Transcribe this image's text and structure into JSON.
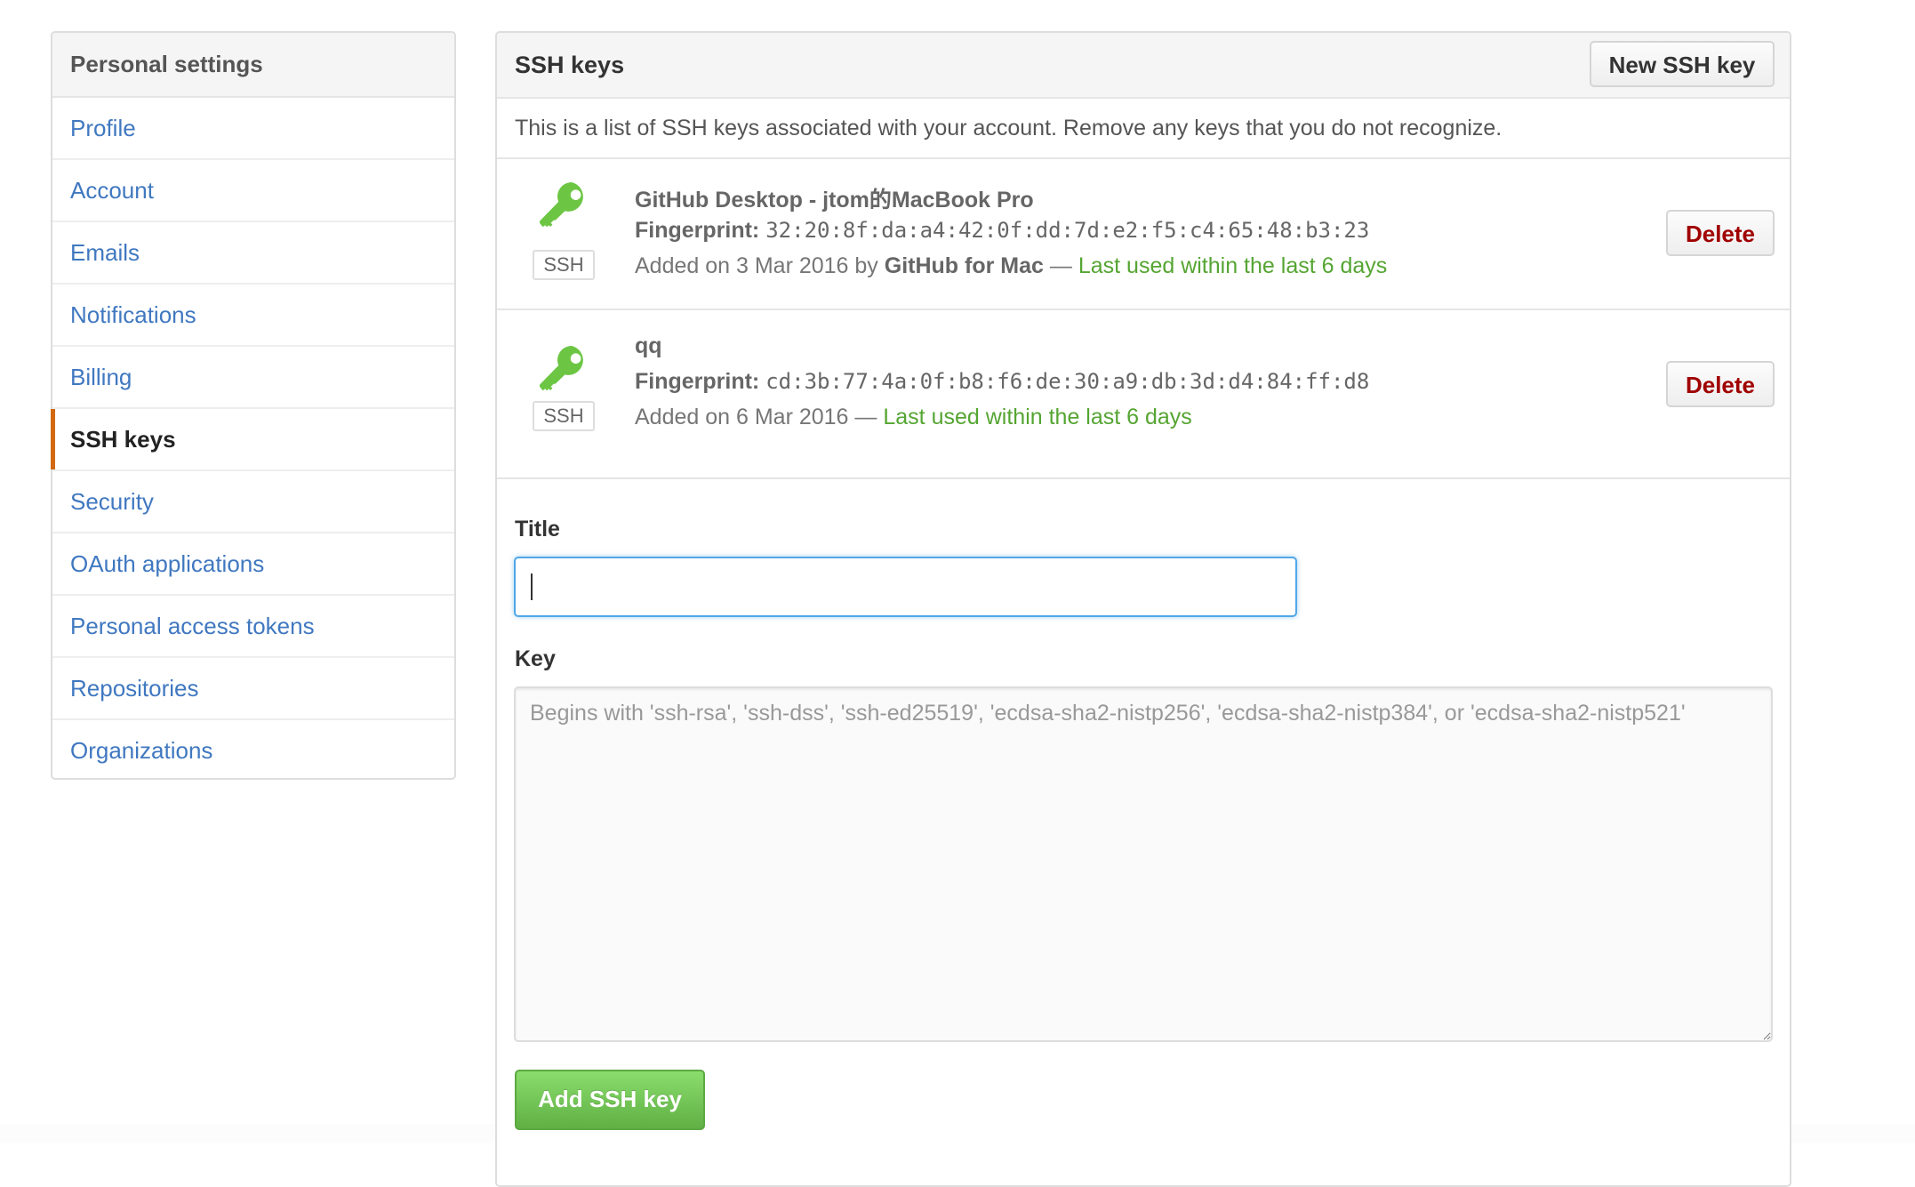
{
  "sidebar": {
    "title": "Personal settings",
    "items": [
      {
        "label": "Profile",
        "selected": false
      },
      {
        "label": "Account",
        "selected": false
      },
      {
        "label": "Emails",
        "selected": false
      },
      {
        "label": "Notifications",
        "selected": false
      },
      {
        "label": "Billing",
        "selected": false
      },
      {
        "label": "SSH keys",
        "selected": true
      },
      {
        "label": "Security",
        "selected": false
      },
      {
        "label": "OAuth applications",
        "selected": false
      },
      {
        "label": "Personal access tokens",
        "selected": false
      },
      {
        "label": "Repositories",
        "selected": false
      },
      {
        "label": "Organizations",
        "selected": false
      }
    ]
  },
  "main": {
    "title": "SSH keys",
    "new_key_label": "New SSH key",
    "description": "This is a list of SSH keys associated with your account. Remove any keys that you do not recognize.",
    "keys": [
      {
        "icon": "key-icon",
        "badge": "SSH",
        "title": "GitHub Desktop - jtom的MacBook Pro",
        "fingerprint_label": "Fingerprint:",
        "fingerprint": "32:20:8f:da:a4:42:0f:dd:7d:e2:f5:c4:65:48:b3:23",
        "added_prefix": "Added on 3 Mar 2016 by",
        "added_by": "GitHub for Mac",
        "separator": "—",
        "last_used": "Last used within the last 6 days",
        "delete_label": "Delete"
      },
      {
        "icon": "key-icon",
        "badge": "SSH",
        "title": "qq",
        "fingerprint_label": "Fingerprint:",
        "fingerprint": "cd:3b:77:4a:0f:b8:f6:de:30:a9:db:3d:d4:84:ff:d8",
        "added_prefix": "Added on 6 Mar 2016",
        "added_by": "",
        "separator": "—",
        "last_used": "Last used within the last 6 days",
        "delete_label": "Delete"
      }
    ],
    "form": {
      "title_label": "Title",
      "title_value": "",
      "key_label": "Key",
      "key_value": "",
      "key_placeholder": "Begins with 'ssh-rsa', 'ssh-dss', 'ssh-ed25519', 'ecdsa-sha2-nistp256', 'ecdsa-sha2-nistp384', or 'ecdsa-sha2-nistp521'",
      "submit_label": "Add SSH key"
    }
  },
  "colors": {
    "link": "#4078c0",
    "selected_accent": "#d26911",
    "key_icon": "#6cc644",
    "last_used": "#55a532",
    "delete_text": "#a00000",
    "focus_border": "#51a7e8",
    "add_button": "#60b044"
  }
}
